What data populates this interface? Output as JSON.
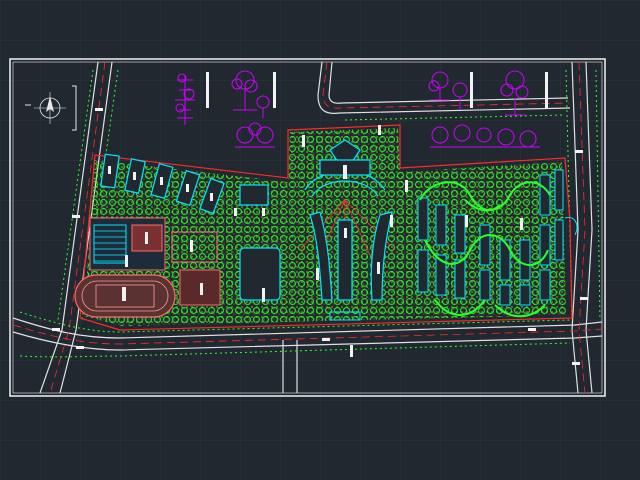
{
  "canvas": {
    "background": "#212830",
    "grid_color": "#2b333d"
  },
  "palette": {
    "border": "#f2f2f2",
    "road": "#e0e0e0",
    "boundary": "#ff2a2a",
    "trees": "#2bff2b",
    "shrub": "#9acd32",
    "buildings": "#00e5ff",
    "sports": "#ff6a6a",
    "elevation": "#d000ff",
    "label": "#f2f2f2"
  },
  "icons": {
    "compass": "north-arrow-icon"
  },
  "elevation_drawings": [
    "tree-elevation-a",
    "tree-elevation-b",
    "tree-elevation-c",
    "tree-elevation-d",
    "tree-elevation-e",
    "tree-elevation-f"
  ]
}
